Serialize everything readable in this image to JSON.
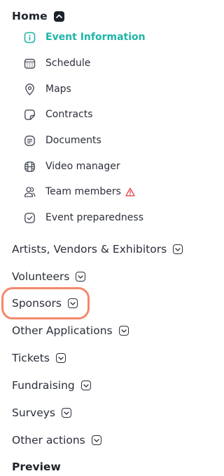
{
  "home": {
    "label": "Home",
    "toggle_icon": "chevron-up-icon"
  },
  "sub_items": [
    {
      "label": "Event Information",
      "icon": "info-icon",
      "active": true
    },
    {
      "label": "Schedule",
      "icon": "calendar-icon"
    },
    {
      "label": "Maps",
      "icon": "map-pin-icon"
    },
    {
      "label": "Contracts",
      "icon": "note-icon"
    },
    {
      "label": "Documents",
      "icon": "document-icon"
    },
    {
      "label": "Video manager",
      "icon": "film-icon"
    },
    {
      "label": "Team members",
      "icon": "team-icon",
      "warning_icon": "warning-triangle-icon"
    },
    {
      "label": "Event preparedness",
      "icon": "check-square-icon"
    }
  ],
  "sections": [
    {
      "label": "Artists, Vendors & Exhibitors"
    },
    {
      "label": "Volunteers"
    },
    {
      "label": "Sponsors",
      "highlighted": true
    },
    {
      "label": "Other Applications"
    },
    {
      "label": "Tickets"
    },
    {
      "label": "Fundraising"
    },
    {
      "label": "Surveys"
    },
    {
      "label": "Other actions"
    },
    {
      "label": "Preview"
    }
  ],
  "colors": {
    "accent": "#1fb5a6",
    "highlight": "#f4896b",
    "warning": "#e5484d",
    "text": "#2b2f3a"
  }
}
